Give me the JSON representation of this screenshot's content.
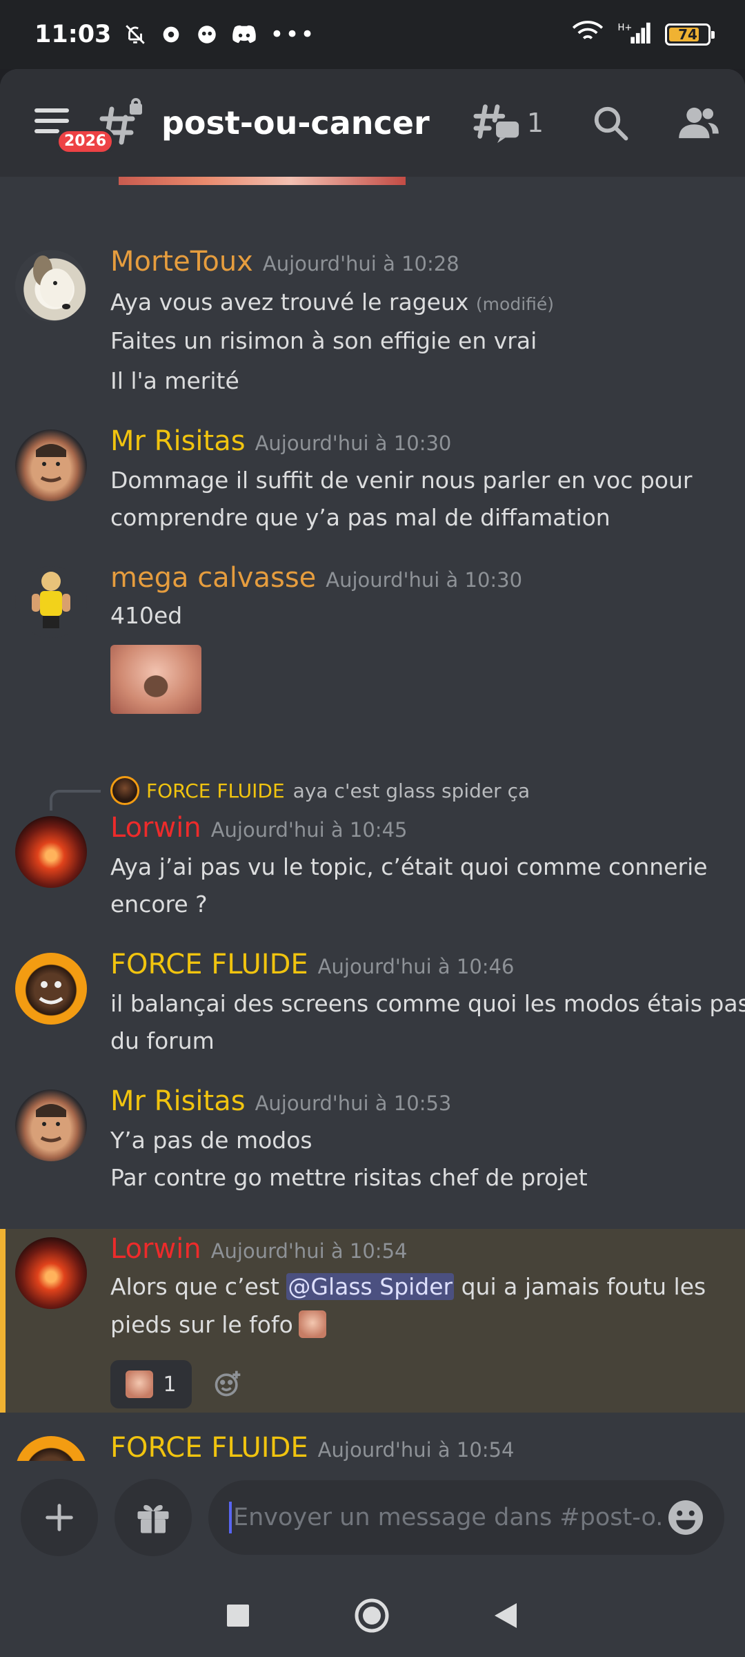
{
  "status_bar": {
    "time": "11:03",
    "battery": "74",
    "icons": [
      "bell-off-icon",
      "gear-icon",
      "app-notification-icon",
      "discord-icon",
      "more-dots-icon",
      "wifi-icon",
      "signal-icon",
      "battery-icon"
    ]
  },
  "header": {
    "channel_name": "post-ou-cancer",
    "notification_badge": "2026",
    "threads_count": "1",
    "icons": [
      "menu-icon",
      "locked-channel-icon",
      "threads-icon",
      "search-icon",
      "members-icon"
    ]
  },
  "messages": [
    {
      "author": "MorteToux",
      "timestamp": "Aujourd'hui à 10:28",
      "lines": [
        "Aya vous avez trouvé le rageux",
        "Faites un risimon à son effigie en vrai",
        "Il l'a merité"
      ],
      "edited": "(modifié)"
    },
    {
      "author": "Mr Risitas",
      "timestamp": "Aujourd'hui à 10:30",
      "lines": [
        "Dommage il suffit de venir nous parler en voc pour",
        "comprendre que y’a pas mal de diffamation"
      ]
    },
    {
      "author": "mega calvasse",
      "timestamp": "Aujourd'hui à 10:30",
      "lines": [
        "410ed"
      ]
    },
    {
      "reply_to": {
        "author": "FORCE FLUIDE",
        "text": "aya c'est glass spider ça"
      },
      "author": "Lorwin",
      "timestamp": "Aujourd'hui à 10:45",
      "lines": [
        "Aya j’ai pas vu le topic, c’était quoi comme connerie",
        "encore ?"
      ]
    },
    {
      "author": "FORCE FLUIDE",
      "timestamp": "Aujourd'hui à 10:46",
      "lines": [
        "il balançai des screens comme quoi les modos étais pas",
        "du forum"
      ]
    },
    {
      "author": "Mr Risitas",
      "timestamp": "Aujourd'hui à 10:53",
      "lines": [
        "Y’a pas de modos",
        "Par contre go mettre risitas chef de projet"
      ]
    },
    {
      "author": "Lorwin",
      "timestamp": "Aujourd'hui à 10:54",
      "line1_pre": "Alors que c’est ",
      "mention": "@Glass Spider",
      "line1_post": " qui a jamais foutu les",
      "line2": "pieds sur le fofo",
      "reaction_count": "1"
    },
    {
      "author": "FORCE FLUIDE",
      "timestamp": "Aujourd'hui à 10:54"
    }
  ],
  "composer": {
    "placeholder": "Envoyer un message dans #post-o..."
  },
  "colors": {
    "background": "#36393f",
    "header": "#2f3136",
    "mention_highlight": "#474339",
    "mention_bar": "#f0b232",
    "blurple": "#5865f2"
  }
}
